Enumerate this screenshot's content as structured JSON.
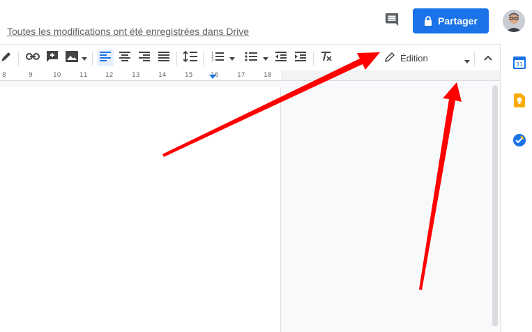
{
  "header": {
    "save_status": "Toutes les modifications ont été enregistrées dans Drive",
    "share_label": "Partager",
    "comment_icon": "comment-icon",
    "lock_icon": "lock-icon"
  },
  "toolbar": {
    "mode_label": "Édition",
    "icons": [
      "paint-format-icon",
      "link-icon",
      "insert-comment-icon",
      "insert-image-icon",
      "align-left-icon",
      "align-center-icon",
      "align-right-icon",
      "align-justify-icon",
      "line-spacing-icon",
      "numbered-list-icon",
      "bulleted-list-icon",
      "decrease-indent-icon",
      "increase-indent-icon",
      "clear-formatting-icon",
      "pencil-icon",
      "collapse-icon"
    ]
  },
  "ruler": {
    "labels": [
      "8",
      "9",
      "10",
      "11",
      "12",
      "13",
      "14",
      "15",
      "16",
      "17",
      "18"
    ]
  },
  "side_panel": {
    "calendar_day": "31"
  },
  "colors": {
    "accent": "#1a73e8",
    "arrow": "#ff0000",
    "keep": "#f9ab00"
  }
}
